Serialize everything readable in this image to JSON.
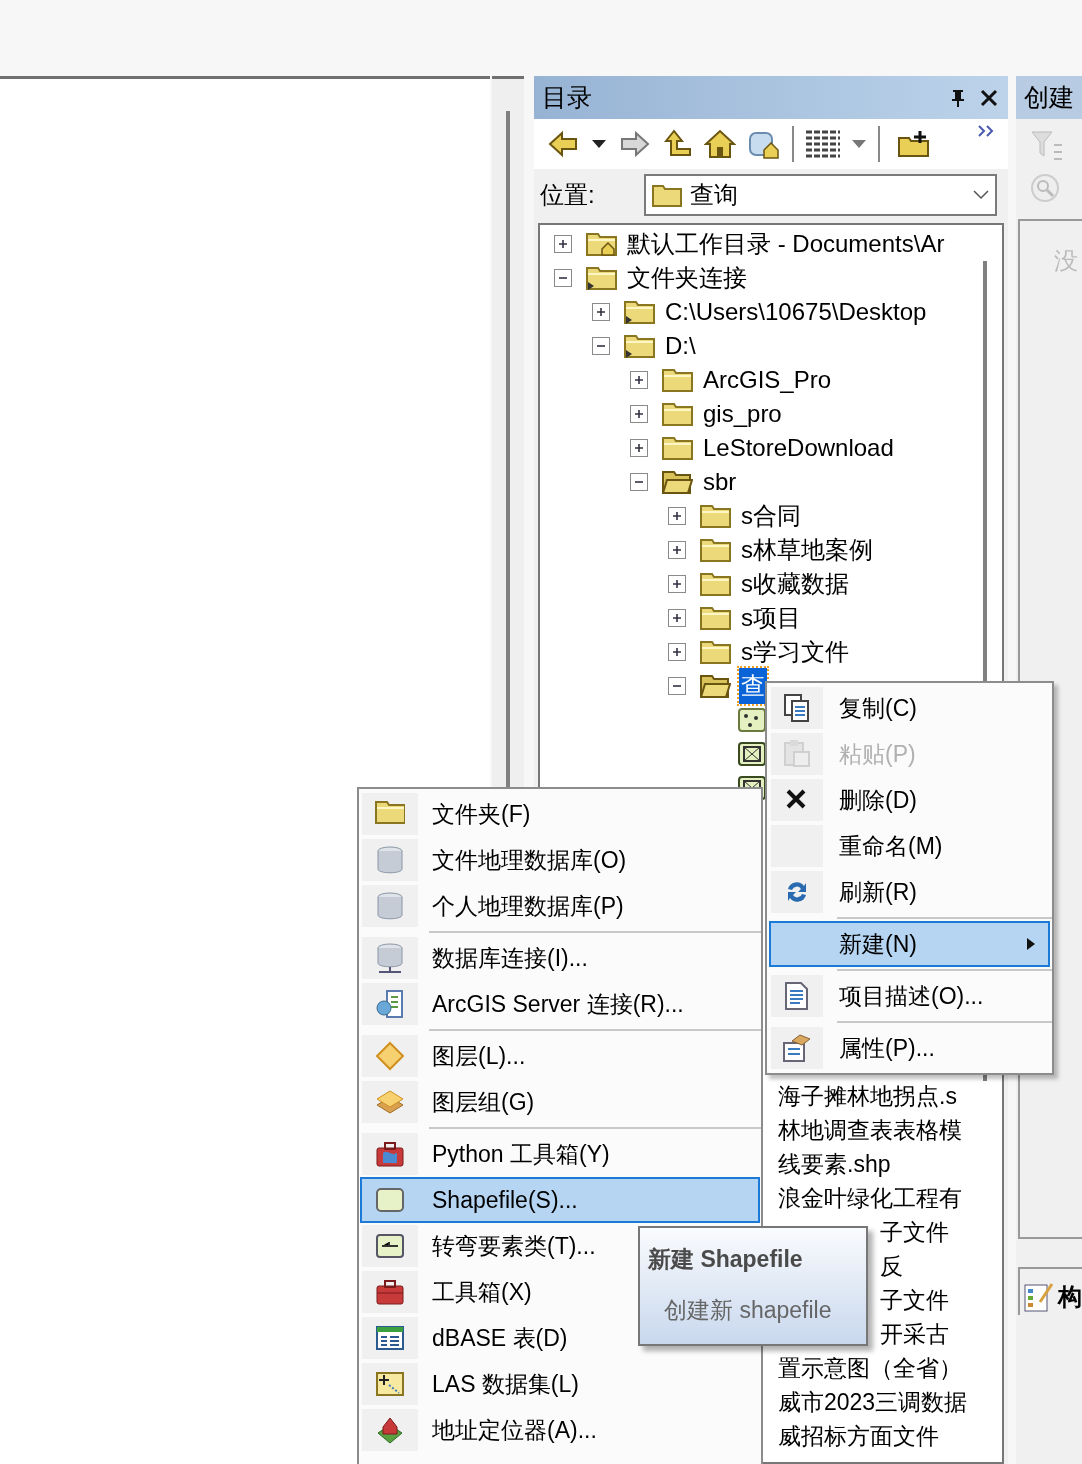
{
  "catalog": {
    "title": "目录",
    "location_label": "位置:",
    "location_value": "查询",
    "tree": [
      {
        "label": "默认工作目录 - Documents\\Ar",
        "kind": "home-folder",
        "expanded": false,
        "selected": false
      },
      {
        "label": "文件夹连接",
        "kind": "link-folder",
        "expanded": true,
        "selected": false,
        "children": [
          {
            "label": "C:\\Users\\10675\\Desktop",
            "kind": "link-folder",
            "expanded": false,
            "selected": false
          },
          {
            "label": "D:\\",
            "kind": "link-folder",
            "expanded": true,
            "selected": false,
            "children": [
              {
                "label": "ArcGIS_Pro",
                "kind": "folder",
                "expanded": false,
                "selected": false
              },
              {
                "label": "gis_pro",
                "kind": "folder",
                "expanded": false,
                "selected": false
              },
              {
                "label": "LeStoreDownload",
                "kind": "folder",
                "expanded": false,
                "selected": false
              },
              {
                "label": "sbr",
                "kind": "folder",
                "expanded": true,
                "selected": false,
                "children": [
                  {
                    "label": "s合同",
                    "kind": "folder",
                    "expanded": false,
                    "selected": false
                  },
                  {
                    "label": "s林草地案例",
                    "kind": "folder",
                    "expanded": false,
                    "selected": false
                  },
                  {
                    "label": "s收藏数据",
                    "kind": "folder",
                    "expanded": false,
                    "selected": false
                  },
                  {
                    "label": "s项目",
                    "kind": "folder",
                    "expanded": false,
                    "selected": false
                  },
                  {
                    "label": "s学习文件",
                    "kind": "folder",
                    "expanded": false,
                    "selected": false
                  },
                  {
                    "label": "查",
                    "kind": "folder",
                    "expanded": true,
                    "selected": true,
                    "children": [
                      {
                        "kind": "point-file",
                        "selected": false
                      },
                      {
                        "kind": "polygon-file",
                        "selected": false
                      },
                      {
                        "kind": "polygon-file",
                        "selected": false
                      },
                      {
                        "label": "海子摊林地拐点.s",
                        "kind": "file",
                        "selected": false
                      },
                      {
                        "label": "林地调查表表格模",
                        "kind": "file",
                        "selected": false
                      },
                      {
                        "label": "线要素.shp",
                        "kind": "file",
                        "selected": false
                      },
                      {
                        "label": "浪金叶绿化工程有",
                        "kind": "file",
                        "selected": false
                      },
                      {
                        "label": "子文件",
                        "kind": "file-tail",
                        "selected": false
                      },
                      {
                        "label": "反",
                        "kind": "file-tail",
                        "selected": false
                      },
                      {
                        "label": "子文件",
                        "kind": "file-tail",
                        "selected": false
                      },
                      {
                        "label": "开采古",
                        "kind": "file-tail",
                        "selected": false
                      },
                      {
                        "label": "置示意图（全省）",
                        "kind": "file",
                        "selected": false
                      },
                      {
                        "label": "威市2023三调数据",
                        "kind": "file",
                        "selected": false
                      },
                      {
                        "label": "威招标方面文件",
                        "kind": "file",
                        "selected": false
                      }
                    ]
                  }
                ]
              }
            ]
          }
        ]
      }
    ]
  },
  "right_panel": {
    "title": "创建",
    "note": "没",
    "bottom_label": "构"
  },
  "context_menu": [
    {
      "label": "复制(C)",
      "disabled": false,
      "selected": false,
      "separator_before": false,
      "submenu": false
    },
    {
      "label": "粘贴(P)",
      "disabled": true,
      "selected": false,
      "separator_before": false,
      "submenu": false
    },
    {
      "label": "删除(D)",
      "disabled": false,
      "selected": false,
      "separator_before": false,
      "submenu": false
    },
    {
      "label": "重命名(M)",
      "disabled": false,
      "selected": false,
      "separator_before": false,
      "submenu": false
    },
    {
      "label": "刷新(R)",
      "disabled": false,
      "selected": false,
      "separator_before": false,
      "submenu": false
    },
    {
      "label": "新建(N)",
      "disabled": false,
      "selected": true,
      "separator_before": true,
      "submenu": true
    },
    {
      "label": "项目描述(O)...",
      "disabled": false,
      "selected": false,
      "separator_before": true,
      "submenu": false
    },
    {
      "label": "属性(P)...",
      "disabled": false,
      "selected": false,
      "separator_before": true,
      "submenu": false
    }
  ],
  "new_menu": [
    {
      "label": "文件夹(F)",
      "selected": false,
      "separator_before": false
    },
    {
      "label": "文件地理数据库(O)",
      "selected": false,
      "separator_before": false
    },
    {
      "label": "个人地理数据库(P)",
      "selected": false,
      "separator_before": false
    },
    {
      "label": "数据库连接(I)...",
      "selected": false,
      "separator_before": true
    },
    {
      "label": "ArcGIS Server 连接(R)...",
      "selected": false,
      "separator_before": false
    },
    {
      "label": "图层(L)...",
      "selected": false,
      "separator_before": true
    },
    {
      "label": "图层组(G)",
      "selected": false,
      "separator_before": false
    },
    {
      "label": "Python 工具箱(Y)",
      "selected": false,
      "separator_before": true
    },
    {
      "label": "Shapefile(S)...",
      "selected": true,
      "separator_before": false
    },
    {
      "label": "转弯要素类(T)...",
      "selected": false,
      "separator_before": false
    },
    {
      "label": "工具箱(X)",
      "selected": false,
      "separator_before": false
    },
    {
      "label": "dBASE 表(D)",
      "selected": false,
      "separator_before": false
    },
    {
      "label": "LAS 数据集(L)",
      "selected": false,
      "separator_before": false
    },
    {
      "label": "地址定位器(A)...",
      "selected": false,
      "separator_before": false
    }
  ],
  "tooltip": {
    "title": "新建 Shapefile",
    "description": "创建新 shapefile"
  }
}
